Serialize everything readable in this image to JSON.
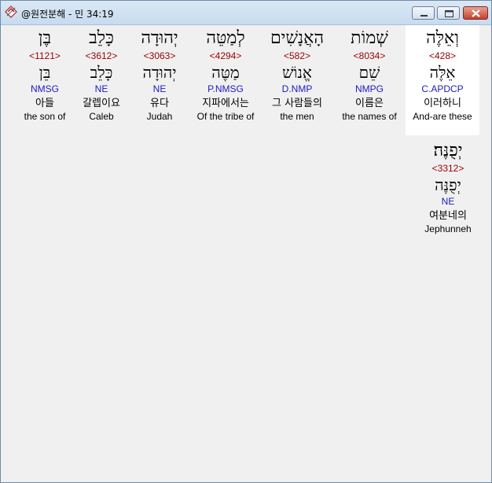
{
  "window": {
    "title": "@원전분해 - 민 34:19",
    "minimize_label": "minimize",
    "maximize_label": "maximize",
    "close_label": "close"
  },
  "words": [
    {
      "hebrew": "וְאֵלֶּה",
      "strong": "<428>",
      "lemma": "אֵלֶּה",
      "morph": "C.APDCP",
      "korean": "이러하니",
      "english": "And-are these",
      "selected": true
    },
    {
      "hebrew": "שְׁמוֹת",
      "strong": "<8034>",
      "lemma": "שֵׁם",
      "morph": "NMPG",
      "korean": "이름은",
      "english": "the names of"
    },
    {
      "hebrew": "הָאֲנָשִׁים",
      "strong": "<582>",
      "lemma": "אֱנוֹשׁ",
      "morph": "D.NMP",
      "korean": "그 사람들의",
      "english": "the men"
    },
    {
      "hebrew": "לְמַטֵּה",
      "strong": "<4294>",
      "lemma": "מַטֶּה",
      "morph": "P.NMSG",
      "korean": "지파에서는",
      "english": "Of the tribe of"
    },
    {
      "hebrew": "יְהוּדָה",
      "strong": "<3063>",
      "lemma": "יְהוּדָה",
      "morph": "NE",
      "korean": "유다",
      "english": "Judah"
    },
    {
      "hebrew": "כָּלֵב",
      "strong": "<3612>",
      "lemma": "כָּלֵב",
      "morph": "NE",
      "korean": "갈렙이요",
      "english": "Caleb"
    },
    {
      "hebrew": "בֶּן",
      "strong": "<1121>",
      "lemma": "בֵּן",
      "morph": "NMSG",
      "korean": "아들",
      "english": "the son of"
    },
    {
      "hebrew": "יְפֻנֶּה׃",
      "strong": "<3312>",
      "lemma": "יְפֻנֶּה",
      "morph": "NE",
      "korean": "여분네의",
      "english": "Jephunneh"
    }
  ]
}
